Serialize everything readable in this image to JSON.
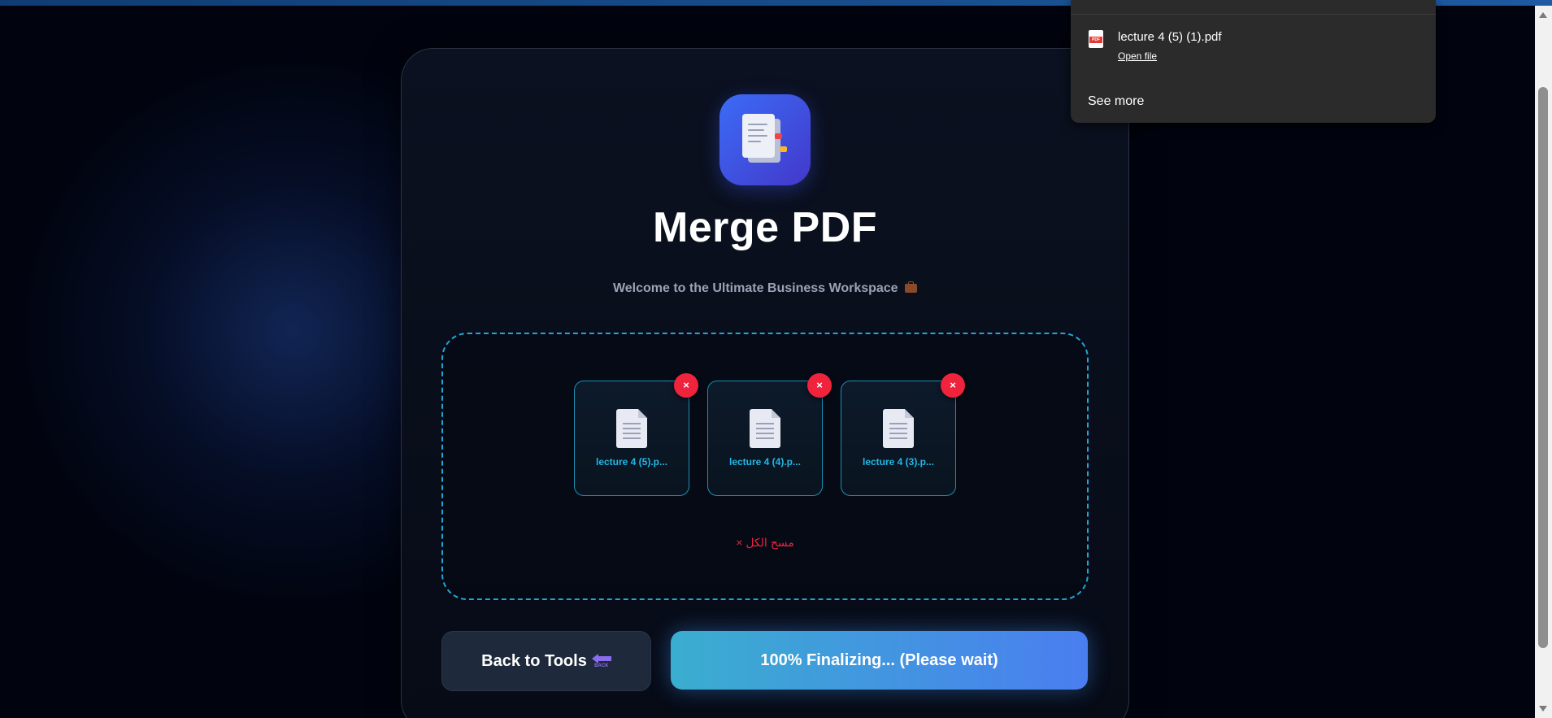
{
  "app": {
    "title": "Merge PDF",
    "subtitle": "Welcome to the Ultimate Business Workspace"
  },
  "files": [
    {
      "name": "lecture 4 (5).p...",
      "remove_label": "×"
    },
    {
      "name": "lecture 4 (4).p...",
      "remove_label": "×"
    },
    {
      "name": "lecture 4 (3).p...",
      "remove_label": "×"
    }
  ],
  "dropzone": {
    "clear_all_label": "مسح الكل ×"
  },
  "actions": {
    "back_label": "Back to Tools",
    "back_icon_text": "BACK",
    "progress_label": "100% Finalizing... (Please wait)",
    "progress_percent": 100
  },
  "downloads": {
    "file_name": "lecture 4 (5) (1).pdf",
    "open_label": "Open file",
    "see_more_label": "See more",
    "file_icon_text": "PDF"
  },
  "colors": {
    "accent": "#22a6d4",
    "danger": "#ef233c",
    "progress_start": "#3aaecf",
    "progress_end": "#4a7ef0"
  },
  "icons": {
    "app": "document-icon",
    "file": "file-icon",
    "remove": "close-icon",
    "back": "back-arrow-icon",
    "download": "pdf-file-icon"
  }
}
